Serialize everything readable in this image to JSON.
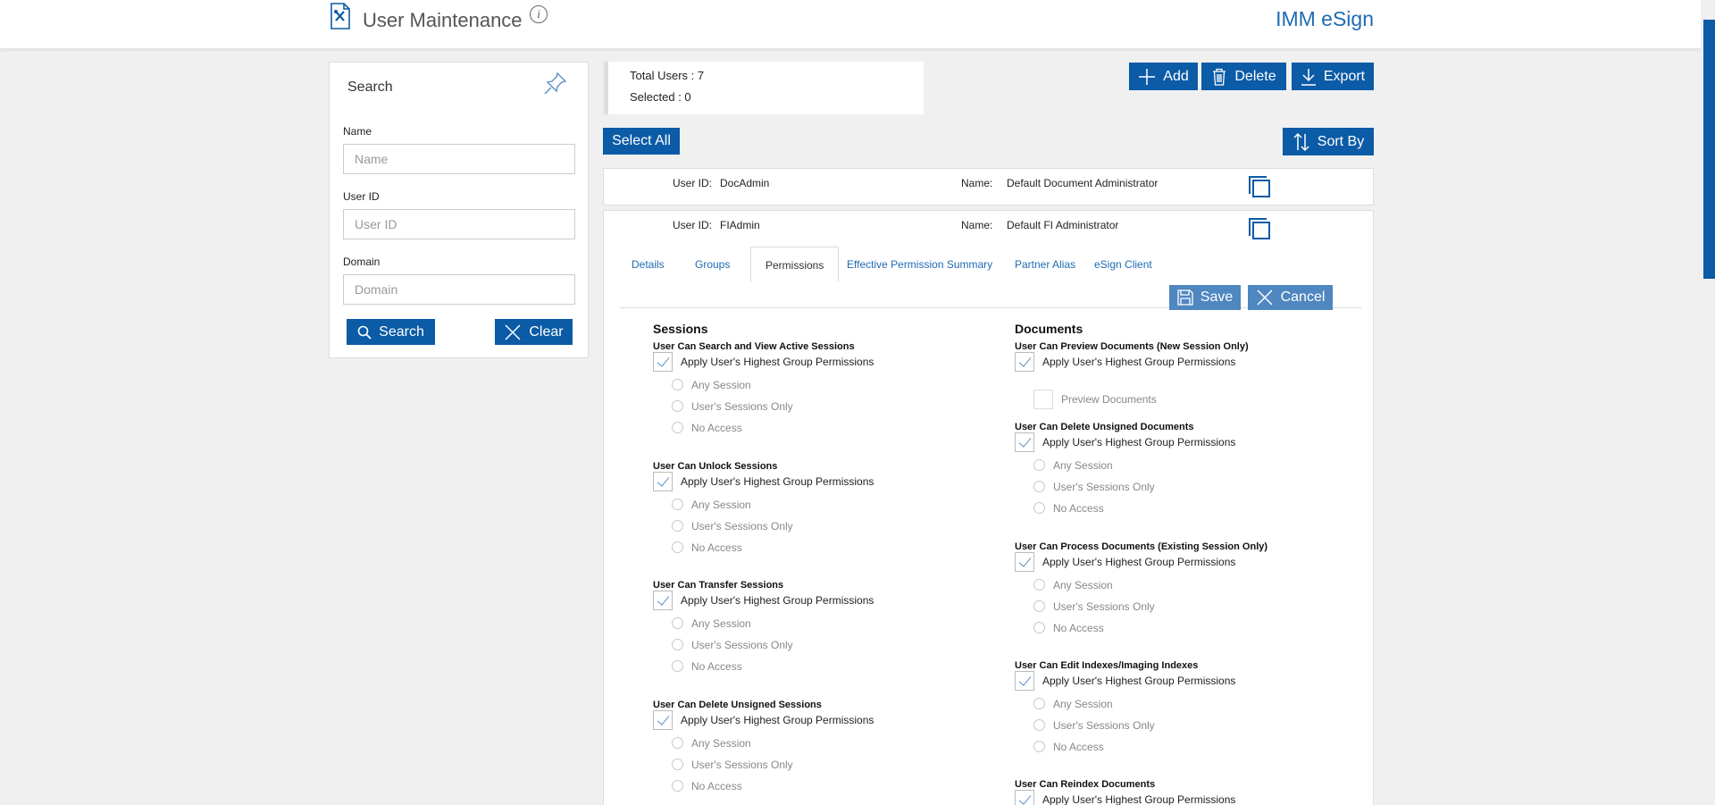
{
  "header": {
    "title": "User Maintenance",
    "brand": "IMM eSign"
  },
  "search": {
    "title": "Search",
    "name_label": "Name",
    "name_placeholder": "Name",
    "userid_label": "User ID",
    "userid_placeholder": "User ID",
    "domain_label": "Domain",
    "domain_placeholder": "Domain",
    "search_button": "Search",
    "clear_button": "Clear"
  },
  "summary": {
    "total_users": "Total Users : 7",
    "selected": "Selected : 0"
  },
  "toolbar": {
    "add": "Add",
    "delete": "Delete",
    "export": "Export",
    "select_all": "Select All",
    "sort_by": "Sort By"
  },
  "users": [
    {
      "userid_label": "User ID:",
      "userid": "DocAdmin",
      "name_label": "Name:",
      "name": "Default Document Administrator"
    },
    {
      "userid_label": "User ID:",
      "userid": "FIAdmin",
      "name_label": "Name:",
      "name": "Default FI Administrator"
    }
  ],
  "tabs": [
    "Details",
    "Groups",
    "Permissions",
    "Effective Permission Summary",
    "Partner Alias",
    "eSign Client"
  ],
  "active_tab": "Permissions",
  "edit_actions": {
    "save": "Save",
    "cancel": "Cancel"
  },
  "permissions": {
    "apply_label": "Apply User's Highest Group Permissions",
    "options": [
      "Any Session",
      "User's Sessions Only",
      "No Access"
    ],
    "sessions": {
      "title": "Sessions",
      "items": [
        "User Can Search and View Active Sessions",
        "User Can Unlock Sessions",
        "User Can Transfer Sessions",
        "User Can Delete Unsigned Sessions"
      ]
    },
    "documents": {
      "title": "Documents",
      "preview_title": "User Can Preview Documents (New Session Only)",
      "preview_option": "Preview Documents",
      "items": [
        "User Can Delete Unsigned Documents",
        "User Can Process Documents (Existing Session Only)",
        "User Can Edit Indexes/Imaging Indexes"
      ],
      "reindex_title": "User Can Reindex Documents"
    }
  },
  "colors": {
    "primary": "#0b5ba6",
    "primary_light": "#4f87c0",
    "brand": "#1f6bb3"
  }
}
